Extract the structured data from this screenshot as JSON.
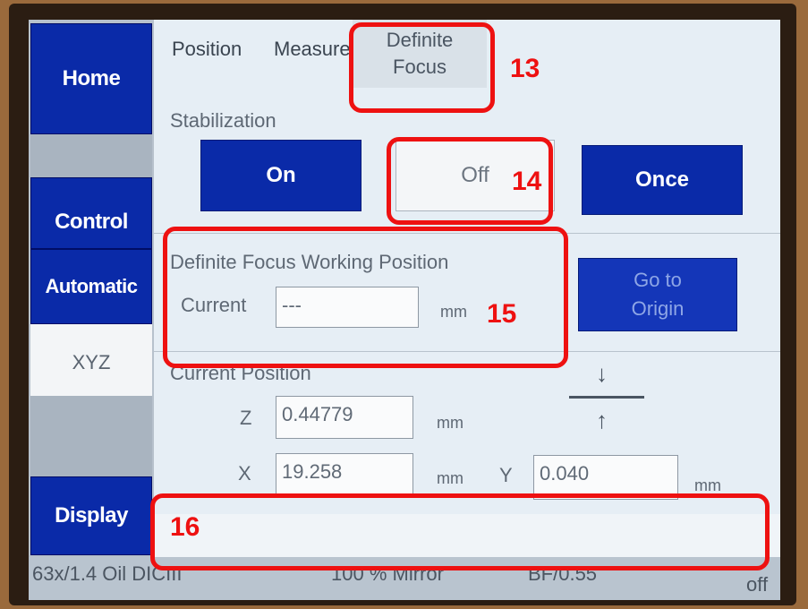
{
  "sidebar": {
    "home": "Home",
    "control": "Control",
    "automatic": "Automatic",
    "xyz": "XYZ",
    "display": "Display"
  },
  "tabs": {
    "position": "Position",
    "measure": "Measure",
    "definite_focus_line1": "Definite",
    "definite_focus_line2": "Focus"
  },
  "stabilization": {
    "label": "Stabilization",
    "on": "On",
    "off": "Off",
    "once": "Once"
  },
  "working_position": {
    "label": "Definite Focus Working Position",
    "current_label": "Current",
    "current_value": "---",
    "unit": "mm",
    "go_origin_line1": "Go to",
    "go_origin_line2": "Origin"
  },
  "current_position": {
    "label": "Current Position",
    "z_label": "Z",
    "z_value": "0.44779",
    "x_label": "X",
    "x_value": "19.258",
    "y_label": "Y",
    "y_value": "0.040",
    "unit": "mm"
  },
  "statusbar": {
    "objective": "63x/1.4 Oil DICIII",
    "mirror": "100 % Mirror",
    "bf": "BF/0.55",
    "state": "off"
  },
  "annotations": {
    "n13": "13",
    "n14": "14",
    "n15": "15",
    "n16": "16"
  },
  "colors": {
    "button_blue": "#0a2aa8",
    "highlight_red": "#ee1111"
  }
}
